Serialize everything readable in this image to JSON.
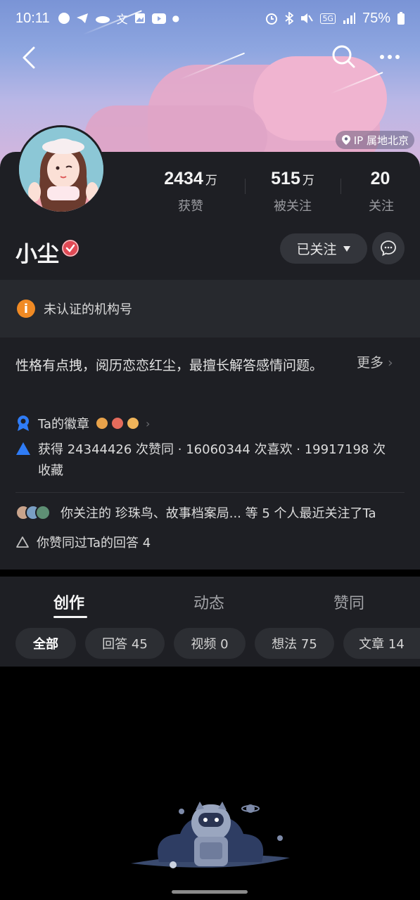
{
  "status_bar": {
    "time": "10:11",
    "battery": "75%",
    "network": "5G"
  },
  "header": {
    "ip_location": "IP 属地北京",
    "icons": [
      "back-arrow-icon",
      "search-icon",
      "more-icon"
    ]
  },
  "profile": {
    "name": "小尘",
    "stats": [
      {
        "num": "2434",
        "unit": "万",
        "label": "获赞"
      },
      {
        "num": "515",
        "unit": "万",
        "label": "被关注"
      },
      {
        "num": "20",
        "unit": "",
        "label": "关注"
      }
    ],
    "follow_button": "已关注",
    "notice": "未认证的机构号",
    "bio": "性格有点拽，阅历恋恋红尘，最擅长解答感情问题。",
    "bio_more": "更多",
    "badges_label": "Ta的徽章",
    "achievements": "获得 24344426 次赞同 · 16060344 次喜欢 · 19917198 次收藏",
    "followers_note": "你关注的 珍珠鸟、故事档案局... 等 5 个人最近关注了Ta",
    "agreed_note": "你赞同过Ta的回答 4"
  },
  "tabs": [
    {
      "label": "创作",
      "active": true
    },
    {
      "label": "动态",
      "active": false
    },
    {
      "label": "赞同",
      "active": false
    }
  ],
  "filters": [
    {
      "label": "全部",
      "active": true
    },
    {
      "label": "回答 45",
      "active": false
    },
    {
      "label": "视频 0",
      "active": false
    },
    {
      "label": "想法 75",
      "active": false
    },
    {
      "label": "文章 14",
      "active": false
    }
  ],
  "colors": {
    "background": "#000000",
    "card": "#1e1f24",
    "verify_badge": "#e04a55",
    "notice_icon": "#f08a24",
    "accent_blue": "#2f7cf6"
  }
}
